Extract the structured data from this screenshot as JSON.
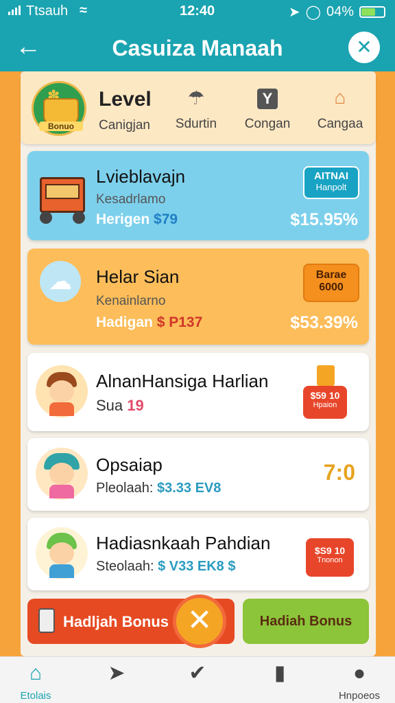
{
  "status": {
    "carrier": "Ttsauh",
    "time": "12:40",
    "battery": "04%"
  },
  "header": {
    "title": "Casuiza Manaah"
  },
  "level": {
    "title": "Level",
    "badge": "Bonuo",
    "subtitle": "Canigjan",
    "items": [
      {
        "label": "Sdurtin",
        "icon": "umbrella-icon"
      },
      {
        "label": "Congan",
        "icon": "y-box-icon"
      },
      {
        "label": "Cangaa",
        "icon": "house-icon"
      }
    ]
  },
  "cards": [
    {
      "name": "Lvieblavajn",
      "sub": "Kesadrlamo",
      "reward_label": "Herigen",
      "reward_value": "$79",
      "percent": "$15.95%",
      "pill_top": "AITNAI",
      "pill_bottom": "Hanpolt",
      "icon": "cart-icon"
    },
    {
      "name": "Helar Sian",
      "sub": "Kenainlarno",
      "reward_label": "Hadigan",
      "reward_value": "$ P137",
      "percent": "$53.39%",
      "pill_top": "Barae",
      "pill_bottom": "6000",
      "icon": "cloud-icon"
    },
    {
      "name": "AlnanHansiga Harlian",
      "sub": "Sua",
      "sub_value": "19",
      "pill_top": "$59 10",
      "pill_bottom": "Hpaion",
      "icon": "boy-avatar-icon"
    },
    {
      "name": "Opsaiap",
      "sub": "Pleolaah:",
      "sub_value": "$3.33 EV8",
      "right_value": "7:0",
      "icon": "girl-avatar-icon"
    },
    {
      "name": "Hadiasnkaah Pahdian",
      "sub": "Steolaah:",
      "sub_value": "$ V33 EK8 $",
      "pill_top": "$S9 10",
      "pill_bottom": "Tnonon",
      "icon": "kid-avatar-icon"
    }
  ],
  "buttons": {
    "left": "Hadljah Bonus",
    "right": "Hadiah Bonus",
    "close": "✕"
  },
  "tabs": [
    {
      "label": "Etolais",
      "icon": "home-icon"
    },
    {
      "label": "",
      "icon": "send-icon"
    },
    {
      "label": "",
      "icon": "check-circle-icon"
    },
    {
      "label": "",
      "icon": "book-icon"
    },
    {
      "label": "Hnpoeos",
      "icon": "profile-icon"
    }
  ]
}
